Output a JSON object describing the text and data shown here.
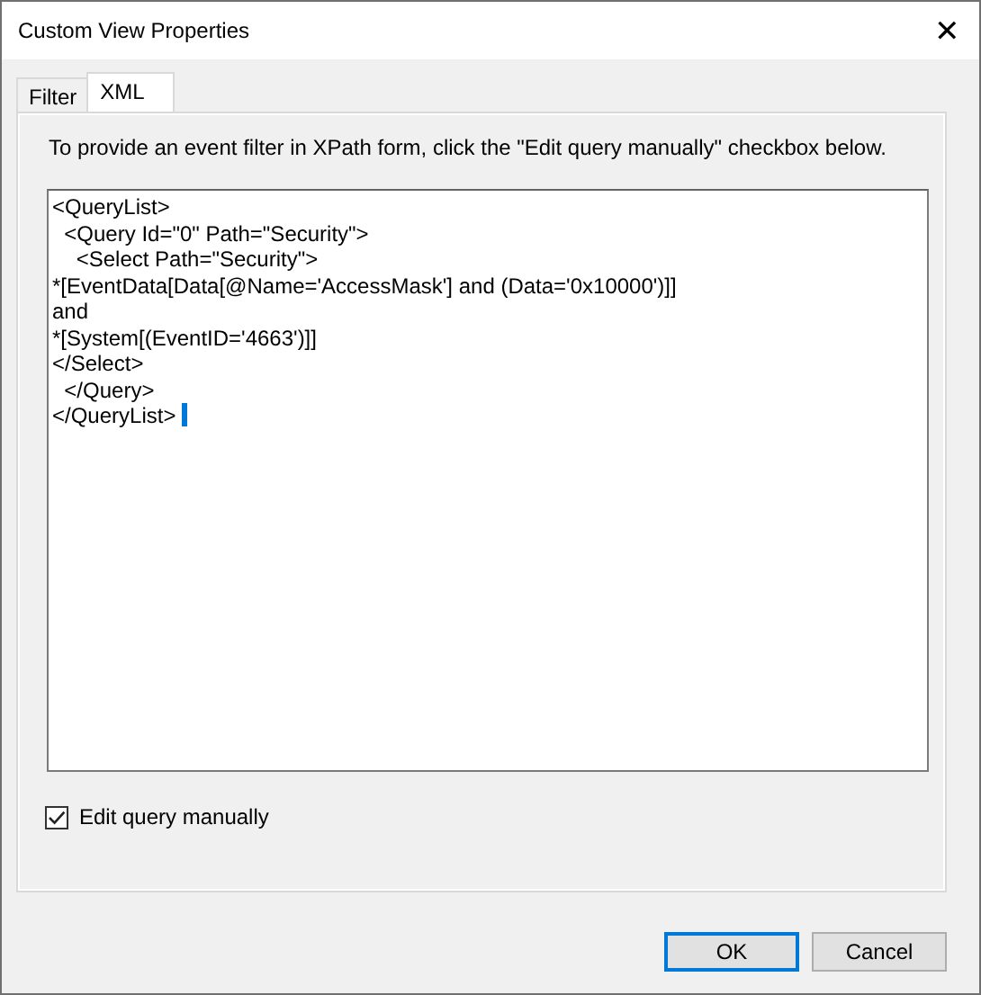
{
  "window": {
    "title": "Custom View Properties",
    "close": "✕"
  },
  "tabs": [
    {
      "label": "Filter",
      "selected": false
    },
    {
      "label": "XML",
      "selected": true
    }
  ],
  "instructions": "To provide an event filter in XPath form, click the \"Edit query manually\" checkbox below.",
  "query_field": {
    "value": "<QueryList>\n  <Query Id=\"0\" Path=\"Security\">\n    <Select Path=\"Security\">\n*[EventData[Data[@Name='AccessMask'] and (Data='0x10000')]]\nand\n*[System[(EventID='4663')]]\n</Select>\n  </Query>\n</QueryList>",
    "focused": true
  },
  "edit_manually": {
    "label": "Edit query manually",
    "checked": true
  },
  "buttons": [
    {
      "label": "OK",
      "default": true
    },
    {
      "label": "Cancel",
      "default": false
    }
  ]
}
